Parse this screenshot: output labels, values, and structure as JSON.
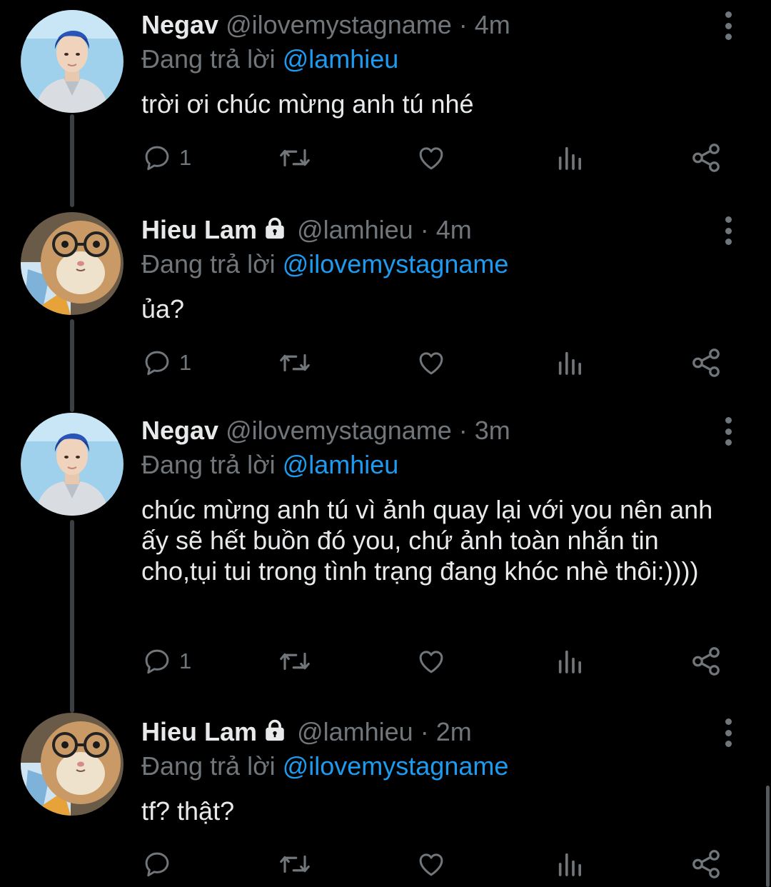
{
  "tweets": [
    {
      "name": "Negav",
      "handle": "@ilovemystagname",
      "dot": "·",
      "time": "4m",
      "replying_prefix": "Đang trả lời",
      "replying_to": "@lamhieu",
      "text": "trời ơi chúc mừng anh tú nhé",
      "reply_count": "1",
      "locked": false,
      "avatar": "person"
    },
    {
      "name": "Hieu Lam",
      "handle": "@lamhieu",
      "dot": "·",
      "time": "4m",
      "replying_prefix": "Đang trả lời",
      "replying_to": "@ilovemystagname",
      "text": "ủa?",
      "reply_count": "1",
      "locked": true,
      "avatar": "cat"
    },
    {
      "name": "Negav",
      "handle": "@ilovemystagname",
      "dot": "·",
      "time": "3m",
      "replying_prefix": "Đang trả lời",
      "replying_to": "@lamhieu",
      "text": "chúc mừng anh tú vì ảnh quay lại với you nên anh ấy sẽ hết buồn đó you, chứ ảnh toàn nhắn tin cho,tụi tui trong tình trạng đang khóc nhè thôi:))))",
      "reply_count": "1",
      "locked": false,
      "avatar": "person"
    },
    {
      "name": "Hieu Lam",
      "handle": "@lamhieu",
      "dot": "·",
      "time": "2m",
      "replying_prefix": "Đang trả lời",
      "replying_to": "@ilovemystagname",
      "text": "tf? thật?",
      "reply_count": "",
      "locked": true,
      "avatar": "cat"
    }
  ],
  "icons": {
    "reply": "reply-icon",
    "retweet": "retweet-icon",
    "like": "like-icon",
    "views": "views-icon",
    "share": "share-icon",
    "more": "more-icon",
    "lock": "lock-icon"
  },
  "colors": {
    "background": "#000000",
    "text": "#e7e9ea",
    "secondary": "#71767b",
    "accent": "#1d9bf0"
  }
}
